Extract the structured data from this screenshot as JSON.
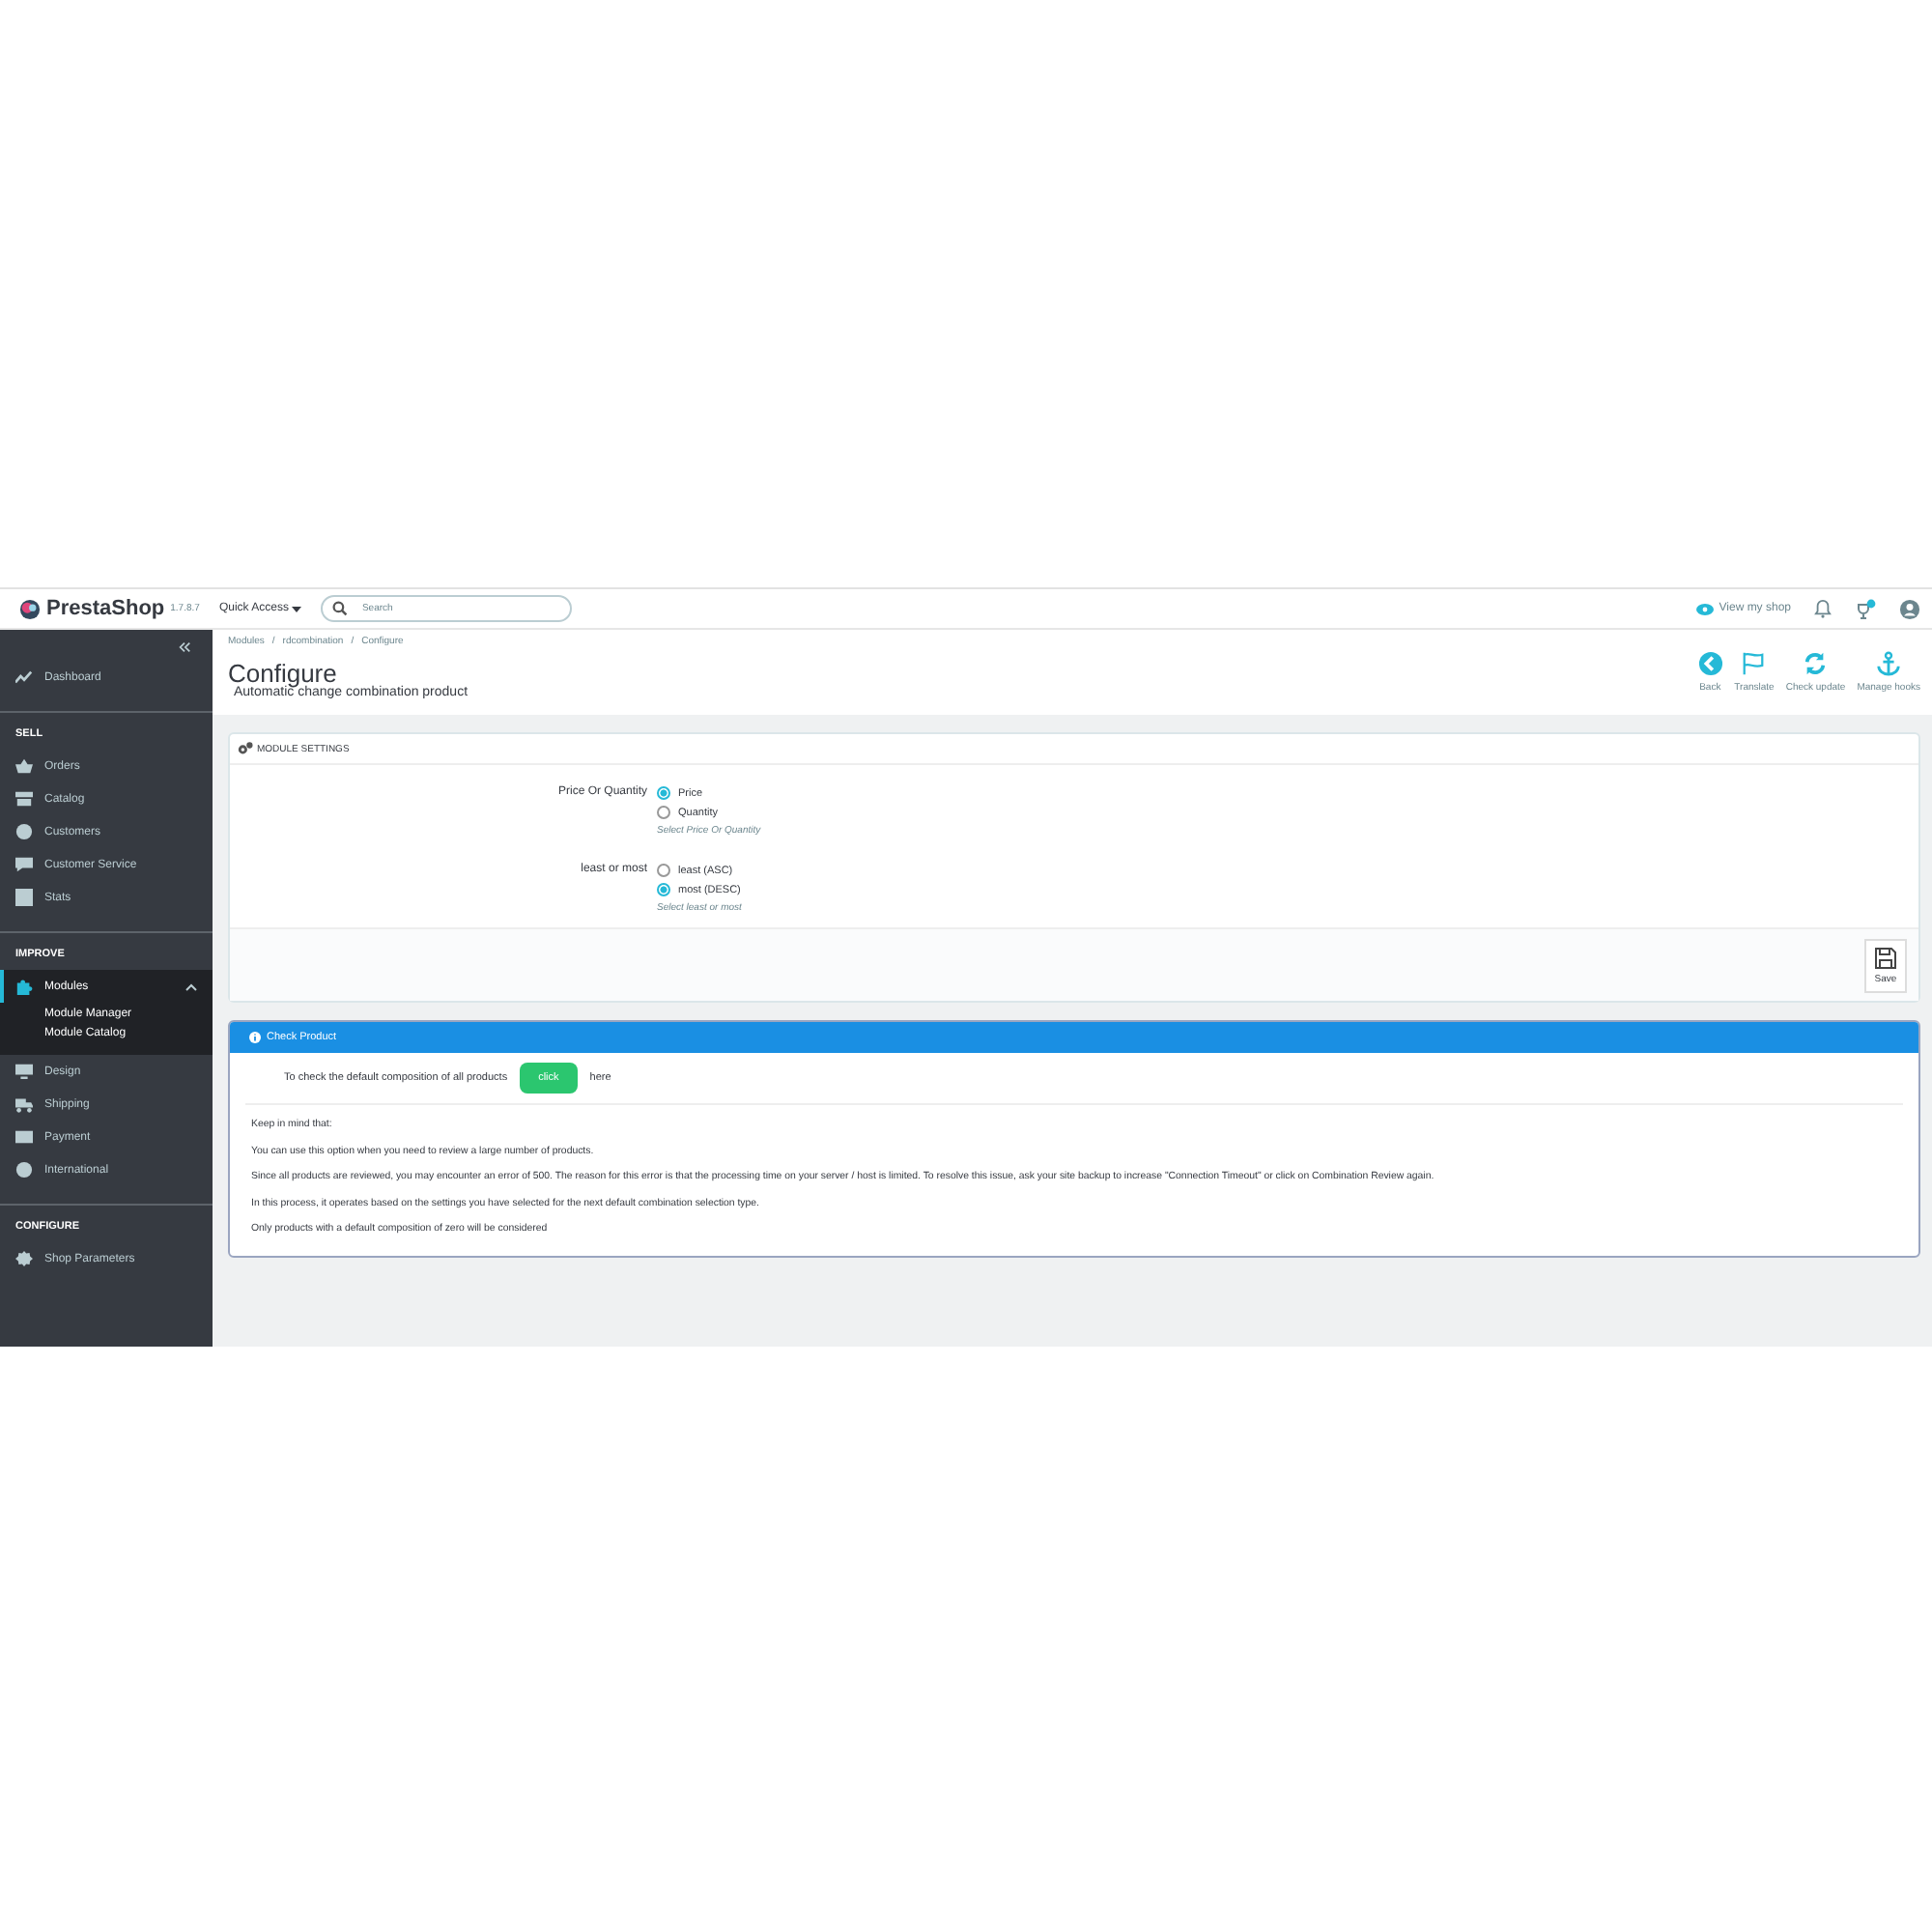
{
  "header": {
    "logo": "PrestaShop",
    "version": "1.7.8.7",
    "quick_access": "Quick Access",
    "search": {
      "placeholder": "Search"
    },
    "view_shop": "View my shop"
  },
  "sidebar": {
    "sections": [
      {
        "items": [
          {
            "label": "Dashboard",
            "selected": false,
            "expanded": false
          }
        ]
      },
      {
        "title": "SELL",
        "items": [
          {
            "label": "Orders",
            "selected": false,
            "expanded": false
          },
          {
            "label": "Catalog",
            "selected": false,
            "expanded": false
          },
          {
            "label": "Customers",
            "selected": false,
            "expanded": false
          },
          {
            "label": "Customer Service",
            "selected": false,
            "expanded": false
          },
          {
            "label": "Stats",
            "selected": false,
            "expanded": false
          }
        ]
      },
      {
        "title": "IMPROVE",
        "items": [
          {
            "label": "Modules",
            "selected": true,
            "expanded": true,
            "children": [
              "Module Manager",
              "Module Catalog"
            ]
          },
          {
            "label": "Design",
            "selected": false,
            "expanded": false
          },
          {
            "label": "Shipping",
            "selected": false,
            "expanded": false
          },
          {
            "label": "Payment",
            "selected": false,
            "expanded": false
          },
          {
            "label": "International",
            "selected": false,
            "expanded": false
          }
        ]
      },
      {
        "title": "CONFIGURE",
        "items": [
          {
            "label": "Shop Parameters",
            "selected": false,
            "expanded": false
          }
        ]
      }
    ]
  },
  "breadcrumb": {
    "items": [
      "Modules",
      "rdcombination",
      "Configure"
    ],
    "separators": [
      "/",
      "/"
    ]
  },
  "page": {
    "title": "Configure",
    "subtitle": "Automatic change combination product"
  },
  "toolbar": [
    "Back",
    "Translate",
    "Check update",
    "Manage hooks"
  ],
  "settings": {
    "title": "MODULE SETTINGS",
    "fields": [
      {
        "label": "Price Or Quantity",
        "options": [
          {
            "label": "Price",
            "selected": true
          },
          {
            "label": "Quantity",
            "selected": false
          }
        ],
        "help": "Select Price Or Quantity"
      },
      {
        "label": "least or most",
        "options": [
          {
            "label": "least (ASC)",
            "selected": false
          },
          {
            "label": "most (DESC)",
            "selected": true
          }
        ],
        "help": "Select least or most"
      }
    ],
    "save": "Save"
  },
  "check": {
    "title": "Check Product",
    "prompt": "To check the default composition of all products",
    "button": "click",
    "after": "here",
    "notes": [
      "Keep in mind that:",
      "You can use this option when you need to review a large number of products.",
      "Since all products are reviewed, you may encounter an error of 500. The reason for this error is that the processing time on your server / host is limited. To resolve this issue, ask your site backup to increase \"Connection Timeout\" or click on Combination Review again.",
      "In this process, it operates based on the settings you have selected for the next default combination selection type.",
      "Only products with a default composition of zero will be considered"
    ]
  }
}
